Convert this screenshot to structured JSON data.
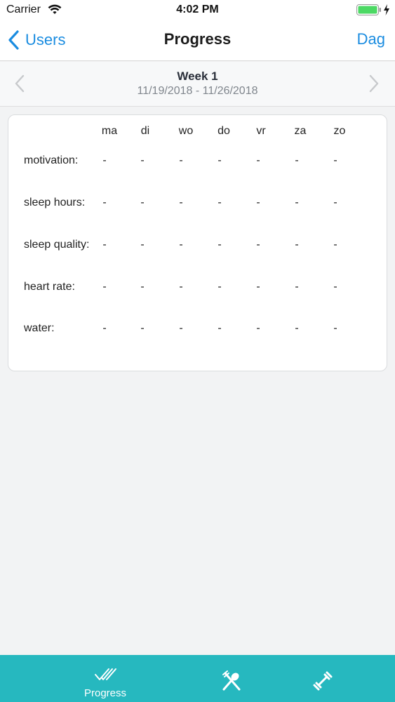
{
  "status_bar": {
    "carrier": "Carrier",
    "time": "4:02 PM",
    "battery_color": "#4cd964"
  },
  "nav": {
    "back_label": "Users",
    "title": "Progress",
    "right_label": "Dag",
    "accent_color": "#1a8ce0"
  },
  "week": {
    "title": "Week 1",
    "dates": "11/19/2018 - 11/26/2018"
  },
  "table": {
    "days": [
      "ma",
      "di",
      "wo",
      "do",
      "vr",
      "za",
      "zo"
    ],
    "rows": [
      {
        "label": "motivation:",
        "values": [
          "-",
          "-",
          "-",
          "-",
          "-",
          "-",
          "-"
        ]
      },
      {
        "label": "sleep hours:",
        "values": [
          "-",
          "-",
          "-",
          "-",
          "-",
          "-",
          "-"
        ]
      },
      {
        "label": "sleep quality:",
        "values": [
          "-",
          "-",
          "-",
          "-",
          "-",
          "-",
          "-"
        ]
      },
      {
        "label": "heart rate:",
        "values": [
          "-",
          "-",
          "-",
          "-",
          "-",
          "-",
          "-"
        ]
      },
      {
        "label": "water:",
        "values": [
          "-",
          "-",
          "-",
          "-",
          "-",
          "-",
          "-"
        ]
      }
    ]
  },
  "tab_bar": {
    "color": "#26b8bf",
    "tabs": [
      {
        "label": "Progress",
        "icon": "checkmarks-icon"
      },
      {
        "label": "",
        "icon": "fork-spoon-icon"
      },
      {
        "label": "",
        "icon": "dumbbell-icon"
      }
    ]
  }
}
